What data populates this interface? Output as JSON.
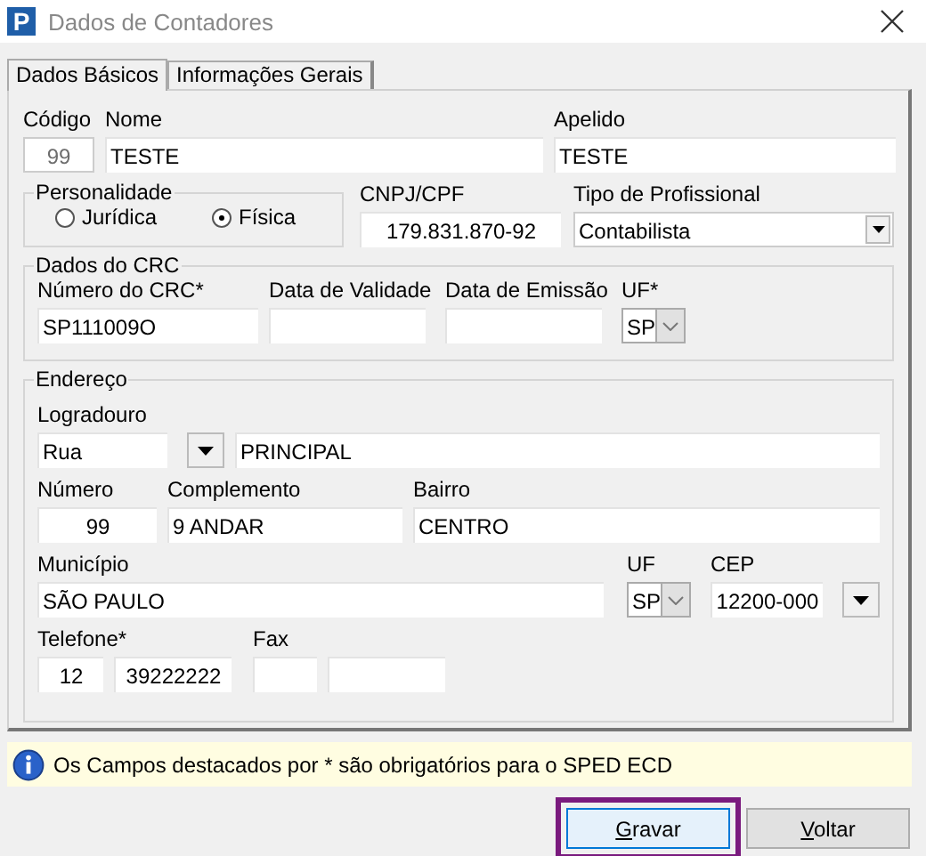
{
  "window": {
    "logo": "P",
    "title": "Dados de Contadores"
  },
  "tabs": [
    {
      "label": "Dados Básicos",
      "selected": true
    },
    {
      "label": "Informações Gerais",
      "selected": false
    }
  ],
  "codigo": {
    "label": "Código",
    "value": "99",
    "disabled": true
  },
  "nome": {
    "label": "Nome",
    "value": "TESTE"
  },
  "apelido": {
    "label": "Apelido",
    "value": "TESTE"
  },
  "personalidade": {
    "title": "Personalidade",
    "options": [
      {
        "label": "Jurídica",
        "selected": false
      },
      {
        "label": "Física",
        "selected": true
      }
    ]
  },
  "cnpj_cpf": {
    "label": "CNPJ/CPF",
    "value": "179.831.870-92"
  },
  "tipo_profissional": {
    "label": "Tipo de Profissional",
    "value": "Contabilista"
  },
  "crc": {
    "title": "Dados do CRC",
    "numero": {
      "label": "Número do CRC*",
      "value": "SP111009O"
    },
    "validade": {
      "label": "Data de Validade"
    },
    "emissao": {
      "label": "Data de Emissão"
    },
    "uf": {
      "label": "UF*",
      "value": "SP"
    }
  },
  "endereco": {
    "title": "Endereço",
    "logradouro": {
      "label": "Logradouro",
      "tipo": "Rua",
      "nome": "PRINCIPAL"
    },
    "numero": {
      "label": "Número",
      "value": "99"
    },
    "complemento": {
      "label": "Complemento",
      "value": "9 ANDAR"
    },
    "bairro": {
      "label": "Bairro",
      "value": "CENTRO"
    },
    "municipio": {
      "label": "Município",
      "value": "SÃO PAULO"
    },
    "uf": {
      "label": "UF",
      "value": "SP"
    },
    "cep": {
      "label": "CEP",
      "value": "12200-000"
    },
    "telefone": {
      "label": "Telefone*",
      "ddd": "12",
      "numero": "39222222"
    },
    "fax": {
      "label": "Fax"
    }
  },
  "info": "Os Campos destacados por * são obrigatórios para o SPED ECD",
  "buttons": [
    {
      "label": "Gravar",
      "focused": true
    },
    {
      "label": "Voltar",
      "focused": false
    }
  ]
}
